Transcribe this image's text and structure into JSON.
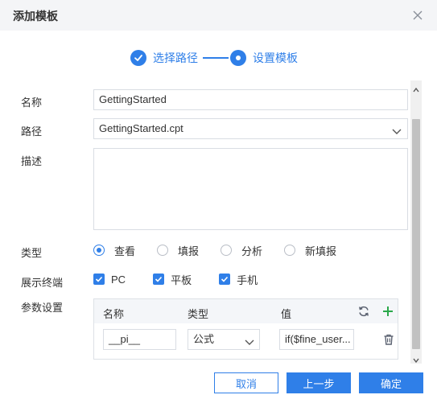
{
  "dialog": {
    "title": "添加模板"
  },
  "steps": [
    {
      "label": "选择路径",
      "state": "done"
    },
    {
      "label": "设置模板",
      "state": "current"
    }
  ],
  "form": {
    "name_label": "名称",
    "name_value": "GettingStarted",
    "path_label": "路径",
    "path_value": "GettingStarted.cpt",
    "desc_label": "描述",
    "desc_value": "",
    "type_label": "类型",
    "type_options": [
      "查看",
      "填报",
      "分析",
      "新填报"
    ],
    "type_selected": "查看",
    "terminal_label": "展示终端",
    "terminal_options": [
      "PC",
      "平板",
      "手机"
    ],
    "terminal_checked": [
      "PC",
      "平板",
      "手机"
    ],
    "params_label": "参数设置"
  },
  "params": {
    "headers": {
      "name": "名称",
      "type": "类型",
      "value": "值"
    },
    "rows": [
      {
        "name": "__pi__",
        "type": "公式",
        "value": "if($fine_user..."
      }
    ]
  },
  "buttons": {
    "cancel": "取消",
    "prev": "上一步",
    "confirm": "确定"
  },
  "colors": {
    "accent": "#2f7fe8",
    "add": "#2aa84a",
    "header_bg": "#f4f5f7"
  }
}
